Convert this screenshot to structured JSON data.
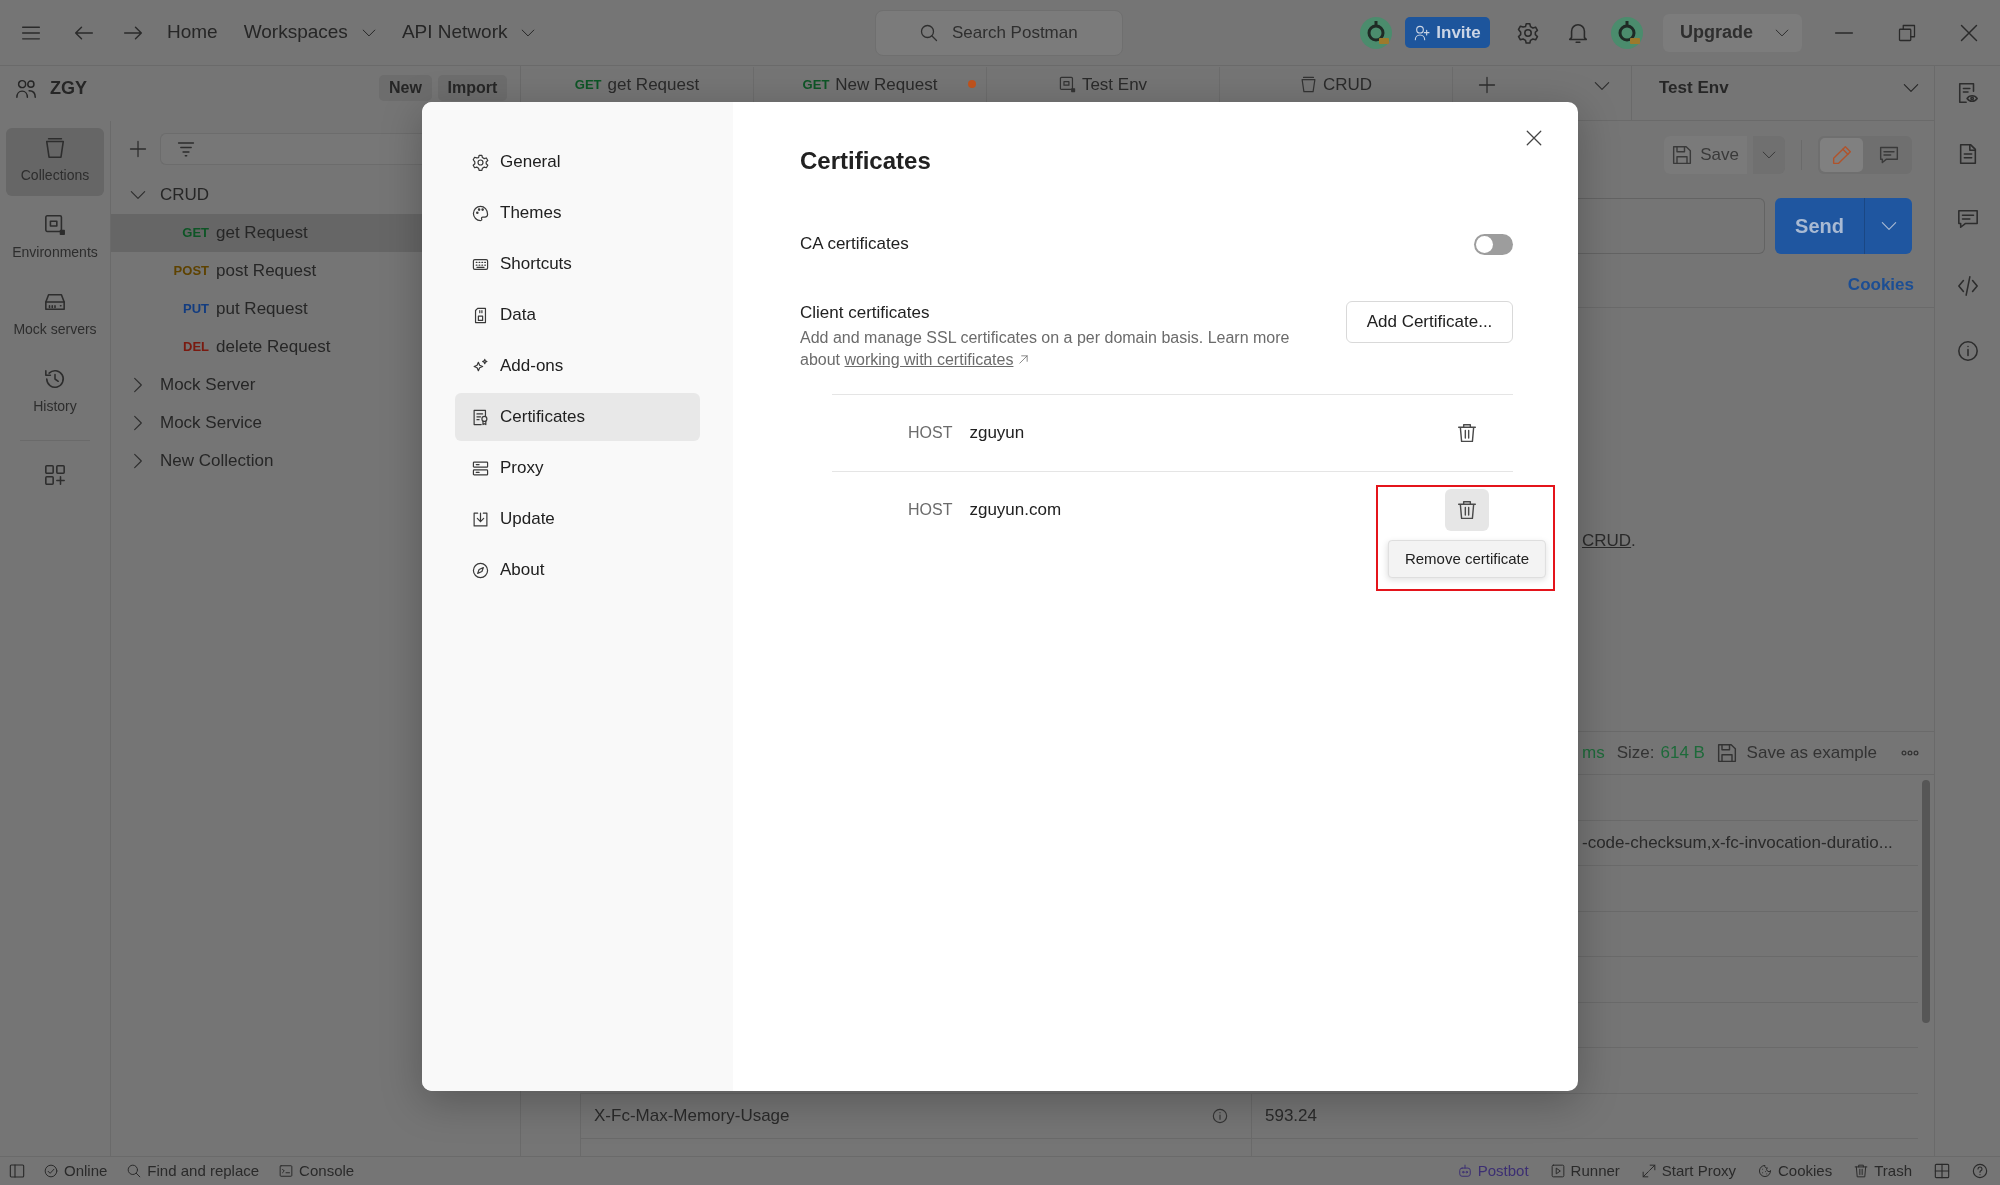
{
  "top_bar": {
    "nav": [
      {
        "label": "Home",
        "menu": false
      },
      {
        "label": "Workspaces",
        "menu": true
      },
      {
        "label": "API Network",
        "menu": true
      }
    ],
    "search": {
      "placeholder": "Search Postman"
    },
    "invite_button": "Invite",
    "upgrade_button": "Upgrade"
  },
  "sidebar": {
    "workspace": "ZGY",
    "new_button": "New",
    "import_button": "Import",
    "rail": [
      {
        "label": "Collections",
        "selected": true
      },
      {
        "label": "Environments",
        "selected": false
      },
      {
        "label": "Mock servers",
        "selected": false
      },
      {
        "label": "History",
        "selected": false
      }
    ],
    "tree": [
      {
        "label": "CRUD",
        "expanded": true,
        "selected": false,
        "children": [
          {
            "method": "GET",
            "color": "#0e5526",
            "label": "get Request",
            "selected": true
          },
          {
            "method": "POST",
            "color": "#5e4200",
            "label": "post Request",
            "selected": false
          },
          {
            "method": "PUT",
            "color": "#123c80",
            "label": "put Request",
            "selected": false
          },
          {
            "method": "DEL",
            "color": "#7a1a10",
            "label": "delete Request",
            "selected": false
          }
        ]
      },
      {
        "label": "Mock Server",
        "expanded": false,
        "selected": false
      },
      {
        "label": "Mock Service",
        "expanded": false,
        "selected": false
      },
      {
        "label": "New Collection",
        "expanded": false,
        "selected": false
      }
    ]
  },
  "tabs": [
    {
      "kind": "request",
      "method": "GET",
      "color": "#0e5526",
      "label": "get Request",
      "unsaved": false
    },
    {
      "kind": "request",
      "method": "GET",
      "color": "#0e5526",
      "label": "New Request",
      "unsaved": true
    },
    {
      "kind": "environment",
      "label": "Test Env",
      "unsaved": false
    },
    {
      "kind": "collection",
      "label": "CRUD",
      "unsaved": false
    }
  ],
  "environment_selector": {
    "label": "Test Env"
  },
  "request": {
    "save_button": "Save",
    "modes": [
      {
        "selected": true
      },
      {
        "selected": false
      }
    ],
    "send_button": "Send",
    "cookies_link": "Cookies",
    "description": {
      "link": "CRUD",
      "tail": "."
    }
  },
  "response": {
    "time_fragment": "ms",
    "size_label": "Size:",
    "size_value": "614 B",
    "save_example_button": "Save as example",
    "header_fragment": "-code-checksum,x-fc-invocation-duratio...",
    "header_row": {
      "key": "X-Fc-Max-Memory-Usage",
      "value": "593.24"
    }
  },
  "settings_dialog": {
    "nav": [
      {
        "label": "General",
        "selected": false
      },
      {
        "label": "Themes",
        "selected": false
      },
      {
        "label": "Shortcuts",
        "selected": false
      },
      {
        "label": "Data",
        "selected": false
      },
      {
        "label": "Add-ons",
        "selected": false
      },
      {
        "label": "Certificates",
        "selected": true
      },
      {
        "label": "Proxy",
        "selected": false
      },
      {
        "label": "Update",
        "selected": false
      },
      {
        "label": "About",
        "selected": false
      }
    ],
    "title": "Certificates",
    "ca_certificates": {
      "label": "CA certificates",
      "on": false
    },
    "client_certificates": {
      "title": "Client certificates",
      "description": "Add and manage SSL certificates on a per domain basis. Learn more about",
      "link": "working with certificates",
      "add_button": "Add Certificate..."
    },
    "certificates": [
      {
        "label": "HOST",
        "host": "zguyun",
        "hovered": false
      },
      {
        "label": "HOST",
        "host": "zguyun.com",
        "hovered": true,
        "tooltip": "Remove certificate"
      }
    ]
  },
  "status_bar": {
    "left": [
      {
        "label": "Online"
      },
      {
        "label": "Find and replace"
      },
      {
        "label": "Console"
      }
    ],
    "right": [
      {
        "label": "Postbot",
        "color": "#3c2f73"
      },
      {
        "label": "Runner",
        "color": "#2a2a2a"
      },
      {
        "label": "Start Proxy",
        "color": "#2a2a2a"
      },
      {
        "label": "Cookies",
        "color": "#2a2a2a"
      },
      {
        "label": "Trash",
        "color": "#2a2a2a"
      }
    ]
  }
}
